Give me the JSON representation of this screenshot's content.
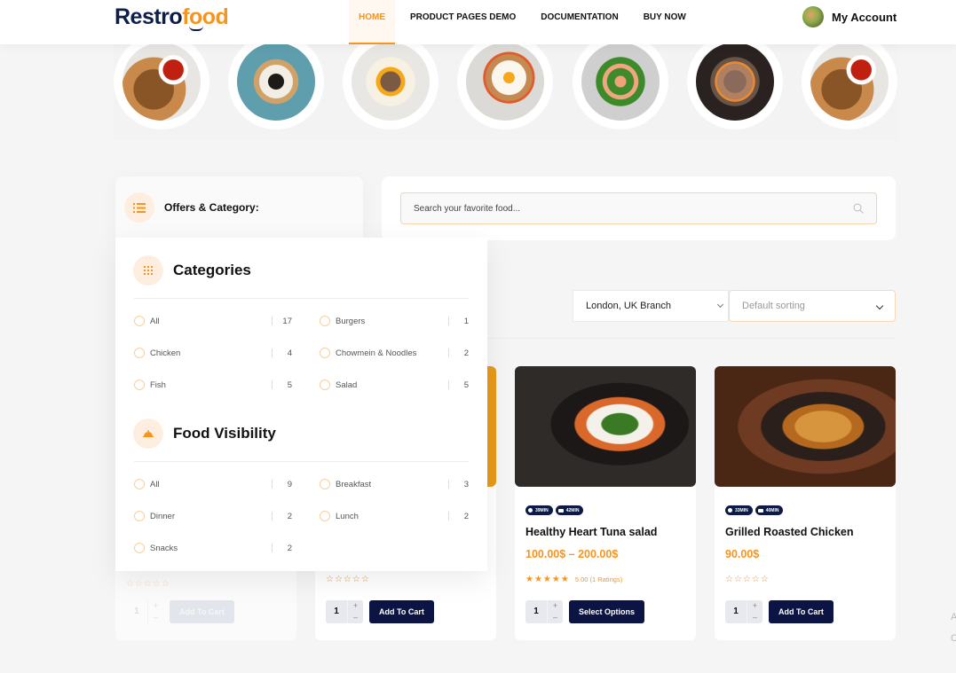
{
  "header": {
    "logo_part1": "Restro",
    "logo_part2": "food",
    "nav": [
      {
        "label": "HOME",
        "active": true
      },
      {
        "label": "PRODUCT PAGES DEMO",
        "active": false
      },
      {
        "label": "DOCUMENTATION",
        "active": false
      },
      {
        "label": "BUY NOW",
        "active": false
      }
    ],
    "account_label": "My Account"
  },
  "category_circles": [
    "grilled-chicken-dish",
    "sushi-dish",
    "egg-salad-dish",
    "fried-egg-dish",
    "shrimp-broccoli-dish",
    "beef-rice-dish",
    "grilled-chicken-dish"
  ],
  "offers": {
    "title": "Offers & Category:"
  },
  "search": {
    "placeholder": "Search your favorite food..."
  },
  "categories": {
    "title": "Categories",
    "items": [
      {
        "label": "All",
        "count": "17"
      },
      {
        "label": "Burgers",
        "count": "1"
      },
      {
        "label": "Chicken",
        "count": "4"
      },
      {
        "label": "Chowmein & Noodles",
        "count": "2"
      },
      {
        "label": "Fish",
        "count": "5"
      },
      {
        "label": "Salad",
        "count": "5"
      }
    ]
  },
  "food_visibility": {
    "title": "Food Visibility",
    "items": [
      {
        "label": "All",
        "count": "9"
      },
      {
        "label": "Breakfast",
        "count": "3"
      },
      {
        "label": "Dinner",
        "count": "2"
      },
      {
        "label": "Lunch",
        "count": "2"
      },
      {
        "label": "Snacks",
        "count": "2"
      }
    ]
  },
  "filters": {
    "branch": "London, UK Branch",
    "sorting": "Default sorting"
  },
  "products": [
    {
      "name": "",
      "price": "",
      "rating_stars": "☆☆☆☆☆",
      "qty": "1",
      "button": "Add To Cart"
    },
    {
      "name": "",
      "price": "",
      "rating_stars": "☆☆☆☆☆",
      "qty": "1",
      "button": "Add To Cart"
    },
    {
      "name": "Healthy Heart Tuna salad",
      "price": "100.00$ – 200.00$",
      "prep_time": "39MIN",
      "delivery_time": "42MIN",
      "rating_stars": "★★★★★",
      "rating_text": "5.00 (1 Ratings)",
      "rating": 5,
      "qty": "1",
      "button": "Select Options"
    },
    {
      "name": "Grilled Roasted Chicken",
      "price": "90.00$",
      "prep_time": "33MIN",
      "delivery_time": "40MIN",
      "rating_stars": "☆☆☆☆☆",
      "rating_text": "",
      "rating": 0,
      "qty": "1",
      "button": "Add To Cart"
    }
  ],
  "colors": {
    "accent": "#f7941d",
    "navy": "#0c1444"
  },
  "edge_text": "A\nC"
}
